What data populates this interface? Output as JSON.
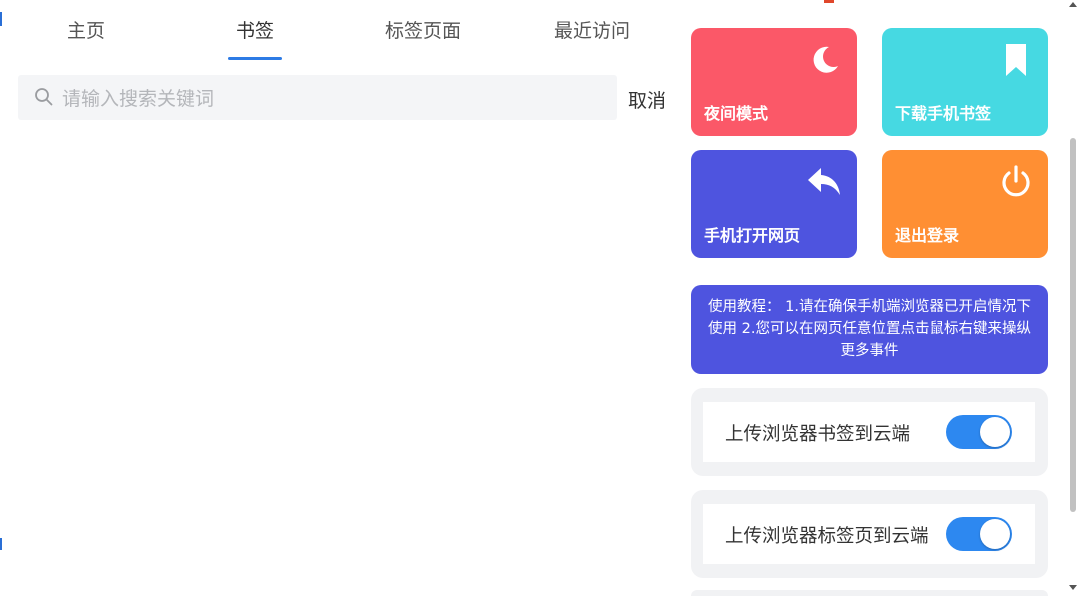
{
  "tabs": [
    {
      "label": "主页"
    },
    {
      "label": "书签"
    },
    {
      "label": "标签页面"
    },
    {
      "label": "最近访问"
    }
  ],
  "active_tab": "书签",
  "search": {
    "placeholder": "请输入搜索关键词",
    "value": "",
    "cancel_label": "取消"
  },
  "tiles": [
    {
      "label": "夜间模式",
      "icon": "moon-icon",
      "color": "#fb5868"
    },
    {
      "label": "下载手机书签",
      "icon": "bookmark-icon",
      "color": "#46d9e2"
    },
    {
      "label": "手机打开网页",
      "icon": "reply-arrow-icon",
      "color": "#4e54df"
    },
    {
      "label": "退出登录",
      "icon": "power-icon",
      "color": "#ff8f33"
    }
  ],
  "tutorial": {
    "text": "使用教程： 1.请在确保手机端浏览器已开启情况下使用 2.您可以在网页任意位置点击鼠标右键来操纵更多事件"
  },
  "toggles": [
    {
      "label": "上传浏览器书签到云端",
      "on": true
    },
    {
      "label": "上传浏览器标签页到云端",
      "on": true
    }
  ],
  "colors": {
    "accent": "#2d7be5",
    "toggle_on": "#2d88f0"
  }
}
